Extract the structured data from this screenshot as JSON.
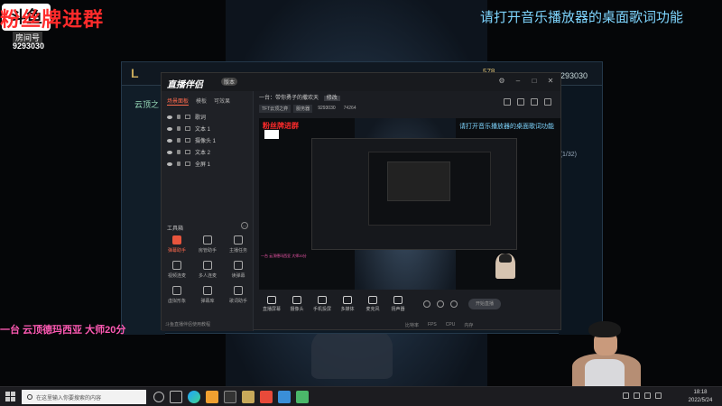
{
  "overlay": {
    "fan_join_text": "粉丝牌进群",
    "logo_text": "斗鱼",
    "room_label": "房间号",
    "room_id": "9293030",
    "lyrics_tip": "请打开音乐播放器的桌面歌词功能",
    "marquee": "一台 云顶德玛西亚 大师20分"
  },
  "game_client": {
    "logo": "L",
    "tab": "云顶之",
    "gold": "578",
    "player_id": "9293030",
    "count": "(1/32)"
  },
  "app": {
    "logo": "直播伴侣",
    "version": "版本",
    "scene_tabs": [
      "场景面板",
      "模板",
      "可效果"
    ],
    "sources": [
      "歌词",
      "文本 1",
      "摄像头 1",
      "文本 2",
      "全屏 1"
    ],
    "tools_heading": "工具箱",
    "tools": [
      "弹幕助手",
      "房管助手",
      "主播任务",
      "视频连麦",
      "多人连麦",
      "读弹幕",
      "虚拟形象",
      "弹幕库",
      "歌词助手"
    ],
    "footer_notice": "斗鱼直播伴侣使用教程",
    "stream_title": "一台：带你勇子的撒欢天",
    "edit_label": "修改",
    "tags": [
      "TFT云顶之弈",
      "服务器"
    ],
    "room_text": "9293030",
    "heat_text": "74264",
    "preview": {
      "fan_text": "粉丝牌进群",
      "lyrics": "请打开音乐播放器的桌面歌词功能",
      "marquee": "一台 云顶德玛西亚 大师20分"
    },
    "bottom_tools": [
      "直播屏幕",
      "摄像头",
      "手机投屏",
      "多媒体",
      "麦克风",
      "扬声器"
    ],
    "start_button": "开始直播",
    "status": [
      "比特率",
      "FPS",
      "CPU",
      "内存"
    ]
  },
  "taskbar": {
    "search_placeholder": "在这里输入你要搜索的内容",
    "time": "18:18",
    "date": "2022/5/24"
  }
}
